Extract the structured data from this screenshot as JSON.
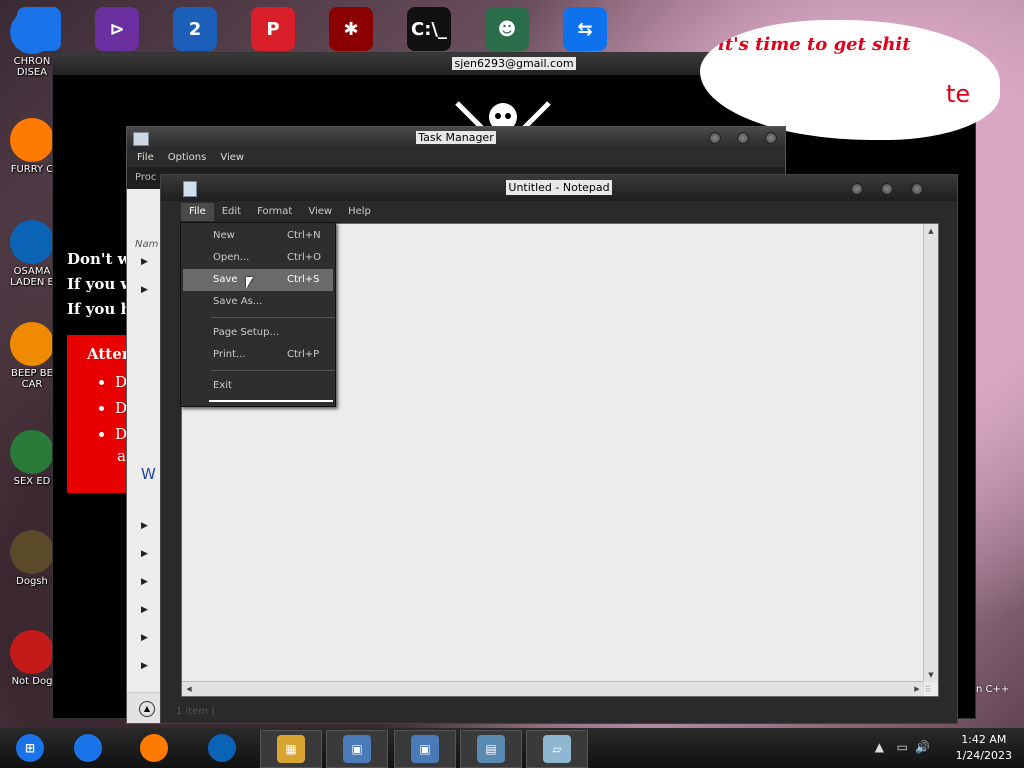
{
  "desktop": {
    "top_icons": [
      {
        "name": "chrome-icon",
        "glyph": "",
        "color": "#1a73e8"
      },
      {
        "name": "visual-studio-icon",
        "glyph": "⊳",
        "color": "#6b2fa0"
      },
      {
        "name": "app-2-icon",
        "glyph": "2",
        "color": "#1c5fb8"
      },
      {
        "name": "app-p-icon",
        "glyph": "P",
        "color": "#d9202a"
      },
      {
        "name": "red-app-icon",
        "glyph": "✱",
        "color": "#8b0000"
      },
      {
        "name": "cmd-icon",
        "glyph": "C:\\_",
        "color": "#111111"
      },
      {
        "name": "game-icon",
        "glyph": "☻",
        "color": "#2b6c4a"
      },
      {
        "name": "teamviewer-icon",
        "glyph": "⇆",
        "color": "#0e72ed"
      }
    ],
    "side_icons": [
      {
        "label": "CHRON\nDISEA",
        "name": "desktop-icon-chrome"
      },
      {
        "label": "FURRY C",
        "name": "desktop-icon-firefox"
      },
      {
        "label": "OSAMA\nLADEN E",
        "name": "desktop-icon-obama"
      },
      {
        "label": "BEEP BE\nCAR",
        "name": "desktop-icon-vlc"
      },
      {
        "label": "SEX ED",
        "name": "desktop-icon-hx"
      },
      {
        "label": "Dogsh",
        "name": "desktop-icon-dogsh"
      },
      {
        "label": "Not Dog",
        "name": "desktop-icon-devcpp"
      }
    ],
    "right_label": "n C++"
  },
  "big_window": {
    "title": "sjen6293@gmail.com",
    "lines": [
      "Don't wo",
      "If you w",
      "If you ha"
    ],
    "attention_title": "Atten",
    "attention_items": [
      "D",
      "D",
      "D"
    ],
    "attention_extra": "a",
    "speech_text": "it's time to get shit",
    "speech_tail": "te"
  },
  "task_manager": {
    "title": "Task Manager",
    "menu": [
      "File",
      "Options",
      "View"
    ],
    "tab_label": "Proc",
    "name_header": "Nam",
    "link_letter": "W",
    "status": "1 item"
  },
  "notepad": {
    "title": "Untitled - Notepad",
    "menu": [
      "File",
      "Edit",
      "Format",
      "View",
      "Help"
    ],
    "file_menu": [
      {
        "label": "New",
        "shortcut": "Ctrl+N"
      },
      {
        "label": "Open...",
        "shortcut": "Ctrl+O"
      },
      {
        "label": "Save",
        "shortcut": "Ctrl+S",
        "highlighted": true
      },
      {
        "label": "Save As...",
        "shortcut": ""
      },
      {
        "sep": true
      },
      {
        "label": "Page Setup...",
        "shortcut": ""
      },
      {
        "label": "Print...",
        "shortcut": "Ctrl+P"
      },
      {
        "sep": true
      },
      {
        "label": "Exit",
        "shortcut": ""
      }
    ]
  },
  "taskbar": {
    "items": [
      {
        "name": "start-button",
        "glyph": "⊞",
        "color": "#1a73e8"
      },
      {
        "name": "taskbar-chrome",
        "glyph": "",
        "color": "#1a73e8"
      },
      {
        "name": "taskbar-firefox",
        "glyph": "",
        "color": "#ff7a00"
      },
      {
        "name": "taskbar-obama",
        "glyph": "",
        "color": "#0b63b6"
      },
      {
        "name": "taskbar-explorer",
        "glyph": "▦",
        "color": "#d9a531"
      },
      {
        "name": "taskbar-app-1",
        "glyph": "▣",
        "color": "#4a7ab8"
      },
      {
        "name": "taskbar-app-2",
        "glyph": "▣",
        "color": "#4a7ab8"
      },
      {
        "name": "taskbar-task-manager",
        "glyph": "▤",
        "color": "#5a8ab0"
      },
      {
        "name": "taskbar-notepad",
        "glyph": "▱",
        "color": "#8fb8d0"
      }
    ],
    "time": "1:42 AM",
    "date": "1/24/2023"
  }
}
